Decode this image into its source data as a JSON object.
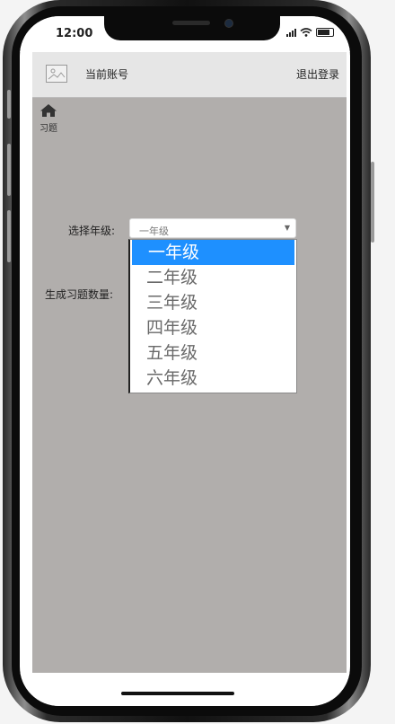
{
  "status_bar": {
    "time": "12:00"
  },
  "header": {
    "account_label": "当前账号",
    "logout_label": "退出登录"
  },
  "nav": {
    "exercise_label": "习题"
  },
  "form": {
    "grade_label": "选择年级:",
    "count_label": "生成习题数量:",
    "grade_selected": "一年级",
    "grade_options": [
      "一年级",
      "二年级",
      "三年级",
      "四年级",
      "五年级",
      "六年级"
    ]
  },
  "colors": {
    "content_background": "#b1aeac",
    "selected_option": "#1e90ff"
  }
}
